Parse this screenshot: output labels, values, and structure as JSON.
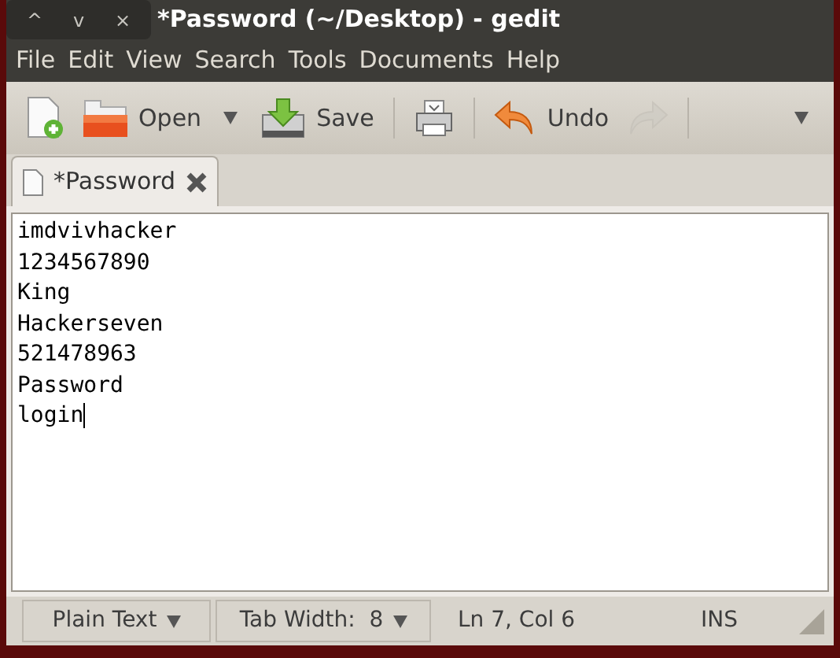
{
  "window": {
    "title": "*Password (~/Desktop) - gedit",
    "controls": [
      "^",
      "v",
      "×"
    ]
  },
  "menu": [
    "File",
    "Edit",
    "View",
    "Search",
    "Tools",
    "Documents",
    "Help"
  ],
  "toolbar": [
    {
      "kind": "new"
    },
    {
      "kind": "open",
      "label": "Open"
    },
    {
      "kind": "dropdown"
    },
    {
      "kind": "save",
      "label": "Save"
    },
    {
      "kind": "separator"
    },
    {
      "kind": "print"
    },
    {
      "kind": "separator"
    },
    {
      "kind": "undo",
      "label": "Undo"
    },
    {
      "kind": "redo",
      "disabled": true
    },
    {
      "kind": "separator"
    },
    {
      "kind": "overflow"
    }
  ],
  "tabs": [
    {
      "label": "*Password",
      "selected": true
    }
  ],
  "editor": {
    "lines": [
      "imdvivhacker",
      "1234567890",
      "King",
      "Hackerseven",
      "521478963",
      "Password",
      "login"
    ]
  },
  "status_bar": {
    "language": "Plain Text",
    "tab_width": "Tab Width:  8",
    "position": "Ln 7, Col 6",
    "mode": "INS"
  }
}
